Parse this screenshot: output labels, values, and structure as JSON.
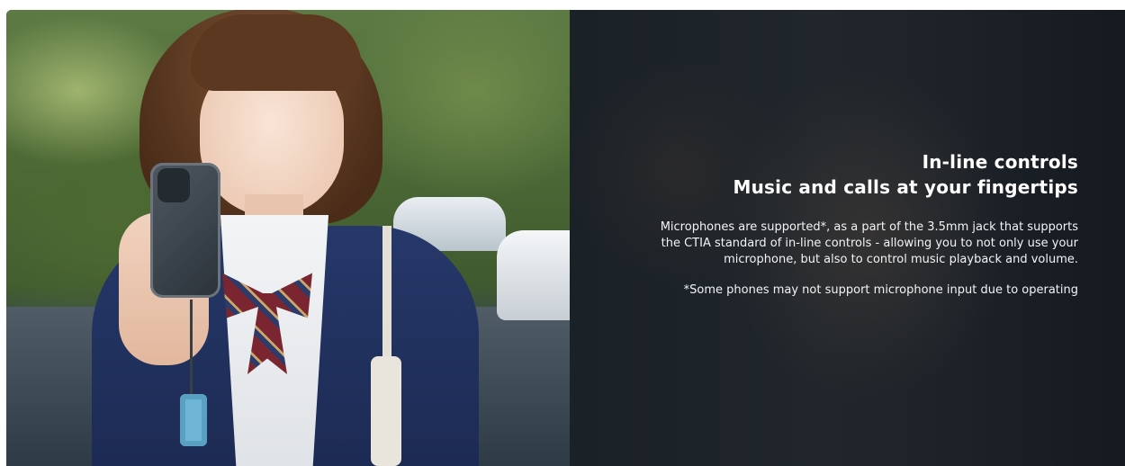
{
  "panel": {
    "heading_line1": "In-line controls",
    "heading_line2": "Music and calls at your fingertips",
    "body_line1": "Microphones are supported*, as a part of the 3.5mm jack that supports",
    "body_line2": "the CTIA standard of in-line controls - allowing you to not only use your",
    "body_line3": "microphone, but also to control music playback and volume.",
    "footnote": "*Some phones may not support microphone input due to operating"
  },
  "photo": {
    "subject": "student-with-wired-earphones-photo"
  },
  "colors": {
    "panel_background": "#1c2228",
    "text": "#ffffff"
  }
}
